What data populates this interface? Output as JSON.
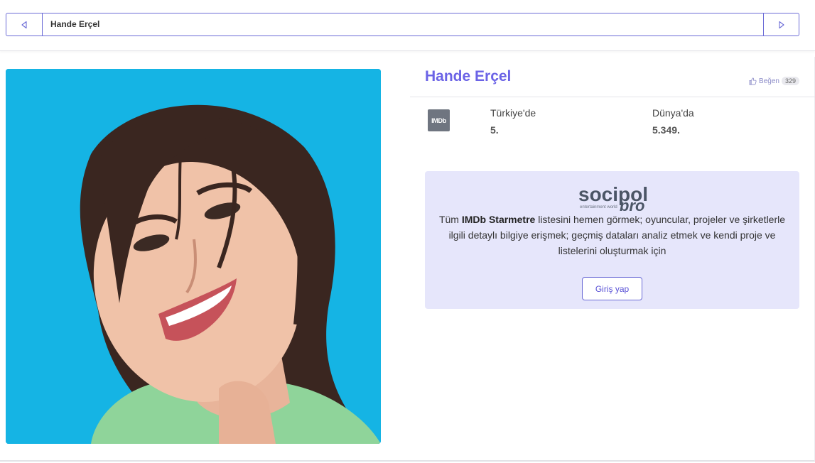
{
  "nav": {
    "title": "Hande Erçel",
    "prev_icon": "chevron-left-icon",
    "next_icon": "chevron-right-icon"
  },
  "profile": {
    "name": "Hande Erçel",
    "like_label": "Beğen",
    "like_count": "329"
  },
  "stats": {
    "source": "IMDb",
    "turkey_label": "Türkiye'de",
    "turkey_rank": "5.",
    "world_label": "Dünya'da",
    "world_rank": "5.349."
  },
  "promo": {
    "brand_main": "socipol",
    "brand_sub": "pro",
    "brand_tagline": "entertainment world",
    "text_prefix": "Tüm ",
    "text_highlight": "IMDb Starmetre",
    "text_rest": " listesini hemen görmek; oyuncular, projeler ve şirketlerle ilgili detaylı bilgiye erişmek; geçmiş dataları analiz etmek ve kendi proje ve listelerini oluşturmak için",
    "login_label": "Giriş yap"
  },
  "colors": {
    "accent": "#6b63e6",
    "photo_bg": "#17b6e6",
    "promo_bg": "#e6e6fb"
  }
}
